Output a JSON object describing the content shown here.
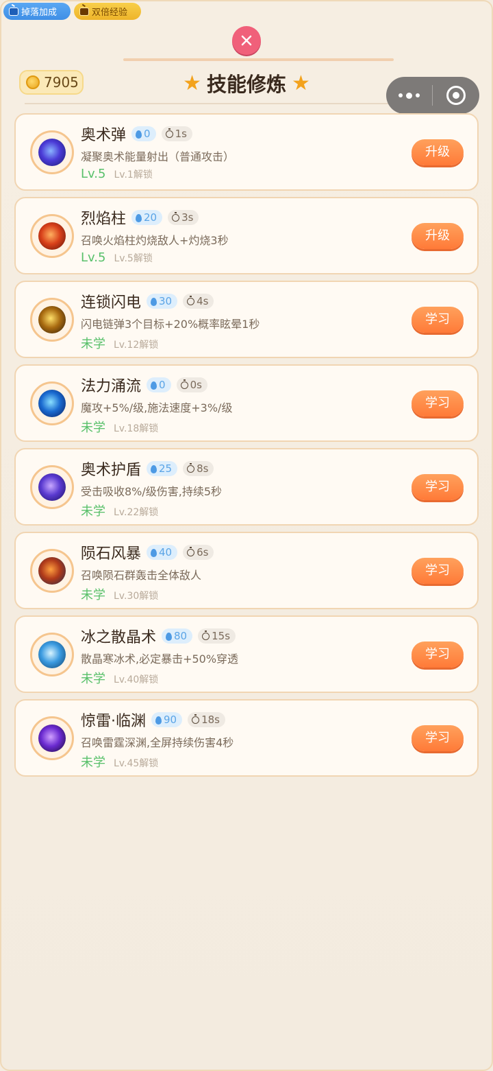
{
  "top_badges": [
    {
      "label": "掉落加成"
    },
    {
      "label": "双倍经验"
    }
  ],
  "coins": {
    "value": "7905"
  },
  "header": {
    "title": "技能修炼"
  },
  "skills": [
    {
      "name": "奥术弹",
      "mana": "0",
      "cooldown": "1s",
      "desc": "凝聚奥术能量射出（普通攻击）",
      "status": "Lv.5",
      "unlock": "Lv.1解锁",
      "action": "升级",
      "orb_colors": [
        "#8ab4ff",
        "#4a3ad6",
        "#1a1a6a"
      ]
    },
    {
      "name": "烈焰柱",
      "mana": "20",
      "cooldown": "3s",
      "desc": "召唤火焰柱灼烧敌人+灼烧3秒",
      "status": "Lv.5",
      "unlock": "Lv.5解锁",
      "action": "升级",
      "orb_colors": [
        "#ffb060",
        "#d8401a",
        "#5a1208"
      ]
    },
    {
      "name": "连锁闪电",
      "mana": "30",
      "cooldown": "4s",
      "desc": "闪电链弹3个目标+20%概率眩晕1秒",
      "status": "未学",
      "unlock": "Lv.12解锁",
      "action": "学习",
      "orb_colors": [
        "#ffe06a",
        "#a86a10",
        "#2a1a08"
      ]
    },
    {
      "name": "法力涌流",
      "mana": "0",
      "cooldown": "0s",
      "desc": "魔攻+5%/级,施法速度+3%/级",
      "status": "未学",
      "unlock": "Lv.18解锁",
      "action": "学习",
      "orb_colors": [
        "#8ae0ff",
        "#1a6ad0",
        "#0a1a5a"
      ]
    },
    {
      "name": "奥术护盾",
      "mana": "25",
      "cooldown": "8s",
      "desc": "受击吸收8%/级伤害,持续5秒",
      "status": "未学",
      "unlock": "Lv.22解锁",
      "action": "学习",
      "orb_colors": [
        "#c8a8ff",
        "#5a3ad0",
        "#1a1060"
      ]
    },
    {
      "name": "陨石风暴",
      "mana": "40",
      "cooldown": "6s",
      "desc": "召唤陨石群轰击全体敌人",
      "status": "未学",
      "unlock": "Lv.30解锁",
      "action": "学习",
      "orb_colors": [
        "#ffa040",
        "#b03a1a",
        "#202a4a"
      ]
    },
    {
      "name": "冰之散晶术",
      "mana": "80",
      "cooldown": "15s",
      "desc": "散晶寒冰术,必定暴击+50%穿透",
      "status": "未学",
      "unlock": "Lv.40解锁",
      "action": "学习",
      "orb_colors": [
        "#d8f4ff",
        "#3a9ae0",
        "#10406a"
      ]
    },
    {
      "name": "惊雷·临渊",
      "mana": "90",
      "cooldown": "18s",
      "desc": "召唤雷霆深渊,全屏持续伤害4秒",
      "status": "未学",
      "unlock": "Lv.45解锁",
      "action": "学习",
      "orb_colors": [
        "#d0a0ff",
        "#6a2ad0",
        "#150830"
      ]
    }
  ]
}
